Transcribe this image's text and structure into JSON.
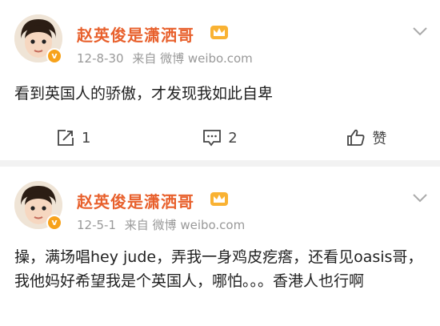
{
  "posts": [
    {
      "username": "赵英俊是潇洒哥",
      "date": "12-8-30",
      "source": "来自 微博 weibo.com",
      "text": "看到英国人的骄傲，才发现我如此自卑",
      "repost_count": "1",
      "comment_count": "2",
      "like_label": "赞"
    },
    {
      "username": "赵英俊是潇洒哥",
      "date": "12-5-1",
      "source": "来自 微博 weibo.com",
      "text": "操，满场唱hey jude，弄我一身鸡皮疙瘩，还看见oasis哥，我他妈好希望我是个英国人，哪怕。。。香港人也行啊"
    }
  ],
  "icons": {
    "repost": "share-icon",
    "comment": "comment-icon",
    "like": "thumbs-up-icon",
    "verified": "verified-badge-icon",
    "member": "crown-icon",
    "menu": "chevron-down-icon"
  },
  "colors": {
    "username": "#e8602c",
    "verified": "#f7a21b",
    "meta": "#999999",
    "background": "#f2f2f2"
  }
}
